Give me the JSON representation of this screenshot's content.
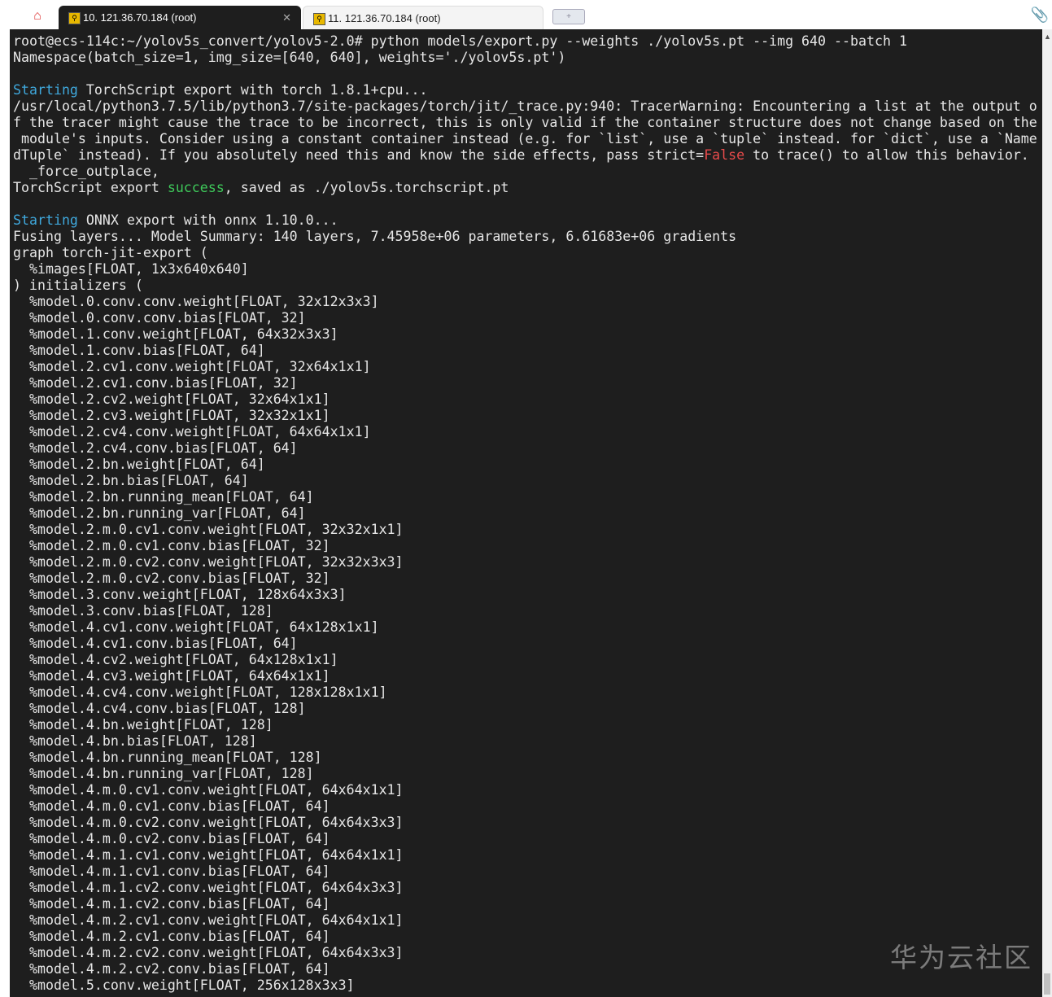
{
  "tabs": [
    {
      "label": "10. 121.36.70.184 (root)",
      "active": true
    },
    {
      "label": "11. 121.36.70.184 (root)",
      "active": false
    }
  ],
  "colors": {
    "cyan": "#3fa8dc",
    "green": "#3ec95a",
    "red": "#e84b4b",
    "text": "#e6e6e6"
  },
  "watermark": "华为云社区",
  "lines": [
    [
      {
        "t": "root@ecs-114c:~/yolov5s_convert/yolov5-2.0# python models/export.py --weights ./yolov5s.pt --img 640 --batch 1"
      }
    ],
    [
      {
        "t": "Namespace(batch_size=1, img_size=[640, 640], weights='./yolov5s.pt')"
      }
    ],
    [
      {
        "t": ""
      }
    ],
    [
      {
        "t": "Starting",
        "c": "cyan"
      },
      {
        "t": " TorchScript export with torch 1.8.1+cpu..."
      }
    ],
    [
      {
        "t": "/usr/local/python3.7.5/lib/python3.7/site-packages/torch/jit/_trace.py:940: TracerWarning: Encountering a list at the output o"
      }
    ],
    [
      {
        "t": "f the tracer might cause the trace to be incorrect, this is only valid if the container structure does not change based on the"
      }
    ],
    [
      {
        "t": " module's inputs. Consider using a constant container instead (e.g. for `list`, use a `tuple` instead. for `dict`, use a `Name"
      }
    ],
    [
      {
        "t": "dTuple` instead). If you absolutely need this and know the side effects, pass strict="
      },
      {
        "t": "False",
        "c": "red"
      },
      {
        "t": " to trace() to allow this behavior."
      }
    ],
    [
      {
        "t": "  _force_outplace,"
      }
    ],
    [
      {
        "t": "TorchScript export "
      },
      {
        "t": "success",
        "c": "green"
      },
      {
        "t": ", saved as ./yolov5s.torchscript.pt"
      }
    ],
    [
      {
        "t": ""
      }
    ],
    [
      {
        "t": "Starting",
        "c": "cyan"
      },
      {
        "t": " ONNX export with onnx 1.10.0..."
      }
    ],
    [
      {
        "t": "Fusing layers... Model Summary: 140 layers, 7.45958e+06 parameters, 6.61683e+06 gradients"
      }
    ],
    [
      {
        "t": "graph torch-jit-export ("
      }
    ],
    [
      {
        "t": "  %images[FLOAT, 1x3x640x640]"
      }
    ],
    [
      {
        "t": ") initializers ("
      }
    ],
    [
      {
        "t": "  %model.0.conv.conv.weight[FLOAT, 32x12x3x3]"
      }
    ],
    [
      {
        "t": "  %model.0.conv.conv.bias[FLOAT, 32]"
      }
    ],
    [
      {
        "t": "  %model.1.conv.weight[FLOAT, 64x32x3x3]"
      }
    ],
    [
      {
        "t": "  %model.1.conv.bias[FLOAT, 64]"
      }
    ],
    [
      {
        "t": "  %model.2.cv1.conv.weight[FLOAT, 32x64x1x1]"
      }
    ],
    [
      {
        "t": "  %model.2.cv1.conv.bias[FLOAT, 32]"
      }
    ],
    [
      {
        "t": "  %model.2.cv2.weight[FLOAT, 32x64x1x1]"
      }
    ],
    [
      {
        "t": "  %model.2.cv3.weight[FLOAT, 32x32x1x1]"
      }
    ],
    [
      {
        "t": "  %model.2.cv4.conv.weight[FLOAT, 64x64x1x1]"
      }
    ],
    [
      {
        "t": "  %model.2.cv4.conv.bias[FLOAT, 64]"
      }
    ],
    [
      {
        "t": "  %model.2.bn.weight[FLOAT, 64]"
      }
    ],
    [
      {
        "t": "  %model.2.bn.bias[FLOAT, 64]"
      }
    ],
    [
      {
        "t": "  %model.2.bn.running_mean[FLOAT, 64]"
      }
    ],
    [
      {
        "t": "  %model.2.bn.running_var[FLOAT, 64]"
      }
    ],
    [
      {
        "t": "  %model.2.m.0.cv1.conv.weight[FLOAT, 32x32x1x1]"
      }
    ],
    [
      {
        "t": "  %model.2.m.0.cv1.conv.bias[FLOAT, 32]"
      }
    ],
    [
      {
        "t": "  %model.2.m.0.cv2.conv.weight[FLOAT, 32x32x3x3]"
      }
    ],
    [
      {
        "t": "  %model.2.m.0.cv2.conv.bias[FLOAT, 32]"
      }
    ],
    [
      {
        "t": "  %model.3.conv.weight[FLOAT, 128x64x3x3]"
      }
    ],
    [
      {
        "t": "  %model.3.conv.bias[FLOAT, 128]"
      }
    ],
    [
      {
        "t": "  %model.4.cv1.conv.weight[FLOAT, 64x128x1x1]"
      }
    ],
    [
      {
        "t": "  %model.4.cv1.conv.bias[FLOAT, 64]"
      }
    ],
    [
      {
        "t": "  %model.4.cv2.weight[FLOAT, 64x128x1x1]"
      }
    ],
    [
      {
        "t": "  %model.4.cv3.weight[FLOAT, 64x64x1x1]"
      }
    ],
    [
      {
        "t": "  %model.4.cv4.conv.weight[FLOAT, 128x128x1x1]"
      }
    ],
    [
      {
        "t": "  %model.4.cv4.conv.bias[FLOAT, 128]"
      }
    ],
    [
      {
        "t": "  %model.4.bn.weight[FLOAT, 128]"
      }
    ],
    [
      {
        "t": "  %model.4.bn.bias[FLOAT, 128]"
      }
    ],
    [
      {
        "t": "  %model.4.bn.running_mean[FLOAT, 128]"
      }
    ],
    [
      {
        "t": "  %model.4.bn.running_var[FLOAT, 128]"
      }
    ],
    [
      {
        "t": "  %model.4.m.0.cv1.conv.weight[FLOAT, 64x64x1x1]"
      }
    ],
    [
      {
        "t": "  %model.4.m.0.cv1.conv.bias[FLOAT, 64]"
      }
    ],
    [
      {
        "t": "  %model.4.m.0.cv2.conv.weight[FLOAT, 64x64x3x3]"
      }
    ],
    [
      {
        "t": "  %model.4.m.0.cv2.conv.bias[FLOAT, 64]"
      }
    ],
    [
      {
        "t": "  %model.4.m.1.cv1.conv.weight[FLOAT, 64x64x1x1]"
      }
    ],
    [
      {
        "t": "  %model.4.m.1.cv1.conv.bias[FLOAT, 64]"
      }
    ],
    [
      {
        "t": "  %model.4.m.1.cv2.conv.weight[FLOAT, 64x64x3x3]"
      }
    ],
    [
      {
        "t": "  %model.4.m.1.cv2.conv.bias[FLOAT, 64]"
      }
    ],
    [
      {
        "t": "  %model.4.m.2.cv1.conv.weight[FLOAT, 64x64x1x1]"
      }
    ],
    [
      {
        "t": "  %model.4.m.2.cv1.conv.bias[FLOAT, 64]"
      }
    ],
    [
      {
        "t": "  %model.4.m.2.cv2.conv.weight[FLOAT, 64x64x3x3]"
      }
    ],
    [
      {
        "t": "  %model.4.m.2.cv2.conv.bias[FLOAT, 64]"
      }
    ],
    [
      {
        "t": "  %model.5.conv.weight[FLOAT, 256x128x3x3]"
      }
    ]
  ]
}
